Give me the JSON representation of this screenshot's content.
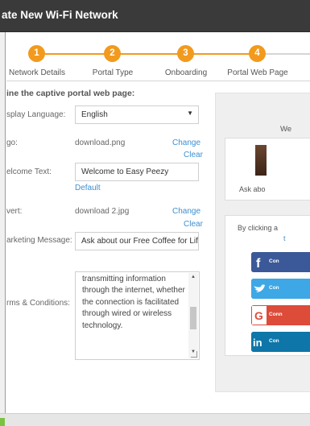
{
  "window": {
    "title": "ate New Wi-Fi Network"
  },
  "stepper": {
    "steps": [
      {
        "number": "1",
        "label": "Network Details"
      },
      {
        "number": "2",
        "label": "Portal Type"
      },
      {
        "number": "3",
        "label": "Onboarding"
      },
      {
        "number": "4",
        "label": "Portal Web Page"
      }
    ],
    "active_color": "#f29a1e"
  },
  "form": {
    "section_title": "ine the captive portal web page:",
    "display_language": {
      "label": "splay Language:",
      "value": "English"
    },
    "logo": {
      "label": "go:",
      "value": "download.png",
      "change": "Change",
      "clear": "Clear"
    },
    "welcome_text": {
      "label": "elcome Text:",
      "value": "Welcome to Easy Peezy",
      "default_link": "Default"
    },
    "advert": {
      "label": "vert:",
      "value": "download 2.jpg",
      "change": "Change",
      "clear": "Clear"
    },
    "marketing_message": {
      "label": "arketing Message:",
      "value": "Ask about our Free Coffee for Life"
    },
    "terms": {
      "label": "rms & Conditions:",
      "text": "transmitting information through the internet, whether the connection is facilitated through wired or wireless technology."
    }
  },
  "preview": {
    "welcome": "We",
    "ask": "Ask abo",
    "clicking": "By clicking a",
    "clicking_tail": "t",
    "buttons": [
      {
        "label": "Con",
        "icon": "facebook-icon",
        "glyph": "f",
        "color": "#3b5998"
      },
      {
        "label": "Con",
        "icon": "twitter-icon",
        "glyph": "t",
        "color": "#1da1f2"
      },
      {
        "label": "Conn",
        "icon": "google-icon",
        "glyph": "G",
        "color": "#dd4b39"
      },
      {
        "label": "Con",
        "icon": "linkedin-icon",
        "glyph": "in",
        "color": "#0e76a8"
      }
    ]
  },
  "colors": {
    "link": "#3d8fd1",
    "accent_green": "#7cc242",
    "titlebar": "#3a3a3a"
  }
}
